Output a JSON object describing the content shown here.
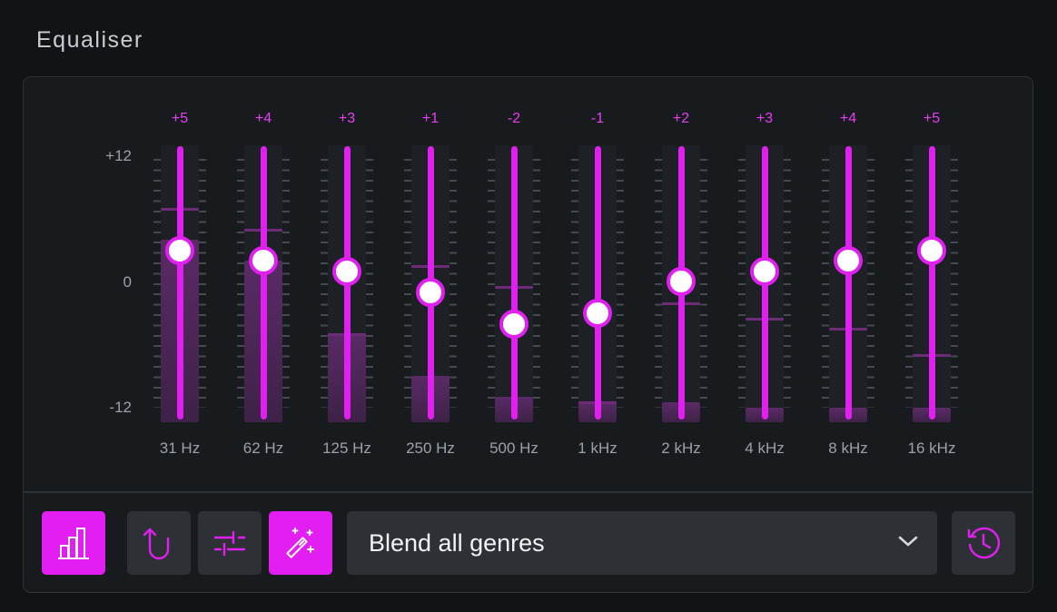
{
  "header": {
    "title": "Equaliser"
  },
  "scale": {
    "top": "+12",
    "mid": "0",
    "bottom": "-12"
  },
  "scale_range": {
    "min": -12,
    "max": 12
  },
  "bands": [
    {
      "freq": "31 Hz",
      "gain_label": "+5",
      "gain": 5,
      "level": 4.0,
      "peak": 7.0
    },
    {
      "freq": "62 Hz",
      "gain_label": "+4",
      "gain": 4,
      "level": 2.0,
      "peak": 5.0
    },
    {
      "freq": "125 Hz",
      "gain_label": "+3",
      "gain": 3,
      "level": -5.0,
      "peak": -5.0
    },
    {
      "freq": "250 Hz",
      "gain_label": "+1",
      "gain": 1,
      "level": -9.0,
      "peak": 1.5
    },
    {
      "freq": "500 Hz",
      "gain_label": "-2",
      "gain": -2,
      "level": -11.0,
      "peak": -0.5
    },
    {
      "freq": "1 kHz",
      "gain_label": "-1",
      "gain": -1,
      "level": -11.5,
      "peak": -11.5
    },
    {
      "freq": "2 kHz",
      "gain_label": "+2",
      "gain": 2,
      "level": -11.5,
      "peak": -2.0
    },
    {
      "freq": "4 kHz",
      "gain_label": "+3",
      "gain": 3,
      "level": -12,
      "peak": -3.5
    },
    {
      "freq": "8 kHz",
      "gain_label": "+4",
      "gain": 4,
      "level": -12,
      "peak": -4.5
    },
    {
      "freq": "16 kHz",
      "gain_label": "+5",
      "gain": 5,
      "level": -12,
      "peak": -7.0
    }
  ],
  "toolbar": {
    "preset_value": "Blend all genres",
    "buttons": [
      {
        "icon": "bar-chart-icon",
        "active": true
      },
      {
        "icon": "undo-arrow-icon",
        "active": false
      },
      {
        "icon": "sliders-icon",
        "active": false
      },
      {
        "icon": "magic-wand-icon",
        "active": true
      },
      {
        "icon": "history-icon",
        "active": false
      }
    ]
  },
  "colors": {
    "accent": "#e01ff0",
    "panel": "#181b1e",
    "button": "#2d3135"
  }
}
